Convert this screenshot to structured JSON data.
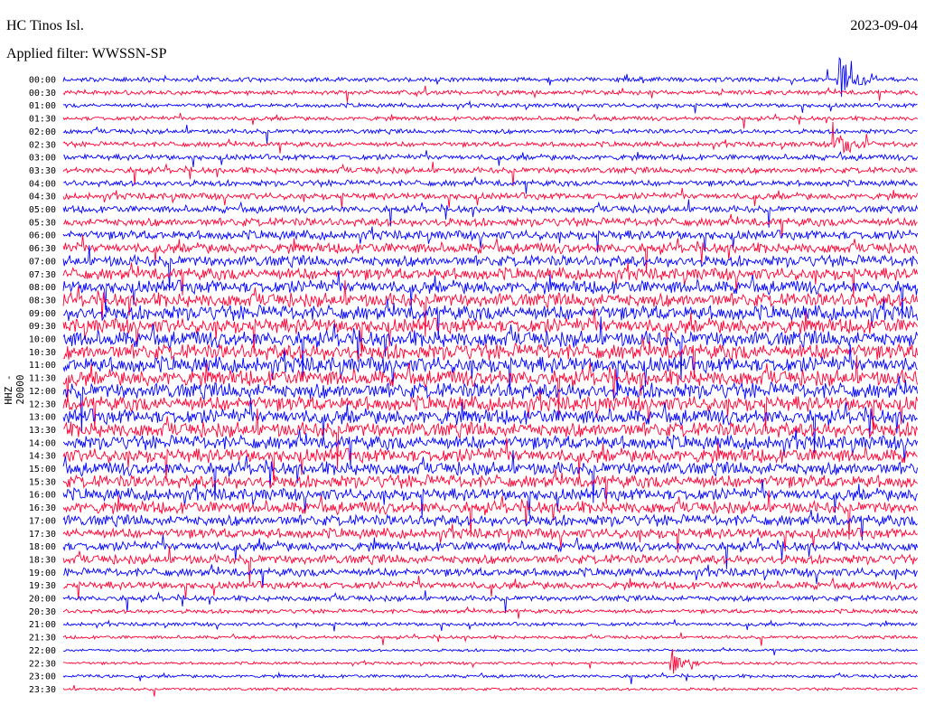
{
  "header": {
    "station": "HC Tinos Isl.",
    "filter": "Applied filter: WWSSN-SP",
    "date": "2023-09-04"
  },
  "chart_data": {
    "type": "line",
    "title": "HC Tinos Isl.",
    "subtitle": "Applied filter: WWSSN-SP",
    "ylabel": "HHZ - 20000",
    "row_labels": [
      "00:00",
      "00:30",
      "01:00",
      "01:30",
      "02:00",
      "02:30",
      "03:00",
      "03:30",
      "04:00",
      "04:30",
      "05:00",
      "05:30",
      "06:00",
      "06:30",
      "07:00",
      "07:30",
      "08:00",
      "08:30",
      "09:00",
      "09:30",
      "10:00",
      "10:30",
      "11:00",
      "11:30",
      "12:00",
      "12:30",
      "13:00",
      "13:30",
      "14:00",
      "14:30",
      "15:00",
      "15:30",
      "16:00",
      "16:30",
      "17:00",
      "17:30",
      "18:00",
      "18:30",
      "19:00",
      "19:30",
      "20:00",
      "20:30",
      "21:00",
      "21:30",
      "22:00",
      "22:30",
      "23:00",
      "23:30"
    ],
    "trace_colors": [
      "#0000ff",
      "#ff0033"
    ],
    "relative_noise_amplitude": [
      0.5,
      0.5,
      0.45,
      0.45,
      0.5,
      0.55,
      0.6,
      0.65,
      0.65,
      0.7,
      0.75,
      0.9,
      1.0,
      1.1,
      1.2,
      1.3,
      1.4,
      1.5,
      1.6,
      1.6,
      1.7,
      1.7,
      1.7,
      1.7,
      1.7,
      1.6,
      1.6,
      1.6,
      1.5,
      1.5,
      1.4,
      1.4,
      1.3,
      1.3,
      1.2,
      1.1,
      1.0,
      1.0,
      0.9,
      0.8,
      0.6,
      0.45,
      0.4,
      0.35,
      0.3,
      0.3,
      0.35,
      0.3
    ],
    "events": [
      {
        "row": 0,
        "x_fraction": 0.905,
        "amplitude": 6.0,
        "duration_fraction": 0.05
      },
      {
        "row": 5,
        "x_fraction": 0.9,
        "amplitude": 3.5,
        "duration_fraction": 0.05
      },
      {
        "row": 45,
        "x_fraction": 0.71,
        "amplitude": 2.5,
        "duration_fraction": 0.04
      }
    ]
  }
}
